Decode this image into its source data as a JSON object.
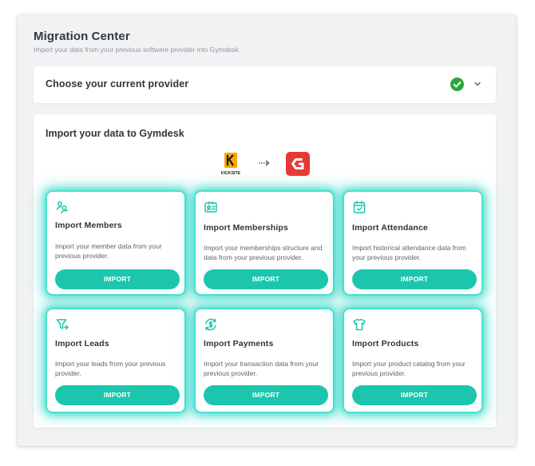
{
  "header": {
    "title": "Migration Center",
    "subtitle": "Import your data from your previous software provider into Gymdesk."
  },
  "provider": {
    "label": "Choose your current provider",
    "status_icon": "check-circle-icon",
    "status_color": "#26a83d",
    "toggle_icon": "chevron-down-icon"
  },
  "import_section": {
    "title": "Import your data to Gymdesk",
    "source_logo": {
      "name": "kicksite-logo",
      "text": "KICKSITE",
      "color": "#f7a800"
    },
    "target_logo": {
      "name": "gymdesk-logo",
      "color": "#e53935"
    },
    "arrow_icon": "dashed-arrow-right-icon"
  },
  "accent_color": "#1cc6ad",
  "tiles": [
    {
      "icon": "members-icon",
      "title": "Import Members",
      "description": "Import your member data from your previous provider.",
      "button": "IMPORT"
    },
    {
      "icon": "membership-card-icon",
      "title": "Import Memberships",
      "description": "Import your memberships structure and data from your previous provider.",
      "button": "IMPORT"
    },
    {
      "icon": "calendar-check-icon",
      "title": "Import Attendance",
      "description": "Import historical attendance data from your previous provider.",
      "button": "IMPORT"
    },
    {
      "icon": "filter-leads-icon",
      "title": "Import Leads",
      "description": "Import your leads from your previous provider.",
      "button": "IMPORT"
    },
    {
      "icon": "payments-icon",
      "title": "Import Payments",
      "description": "Import your transaction data from your previous provider.",
      "button": "IMPORT"
    },
    {
      "icon": "shirt-icon",
      "title": "Import Products",
      "description": "Import your product catalog from your previous provider.",
      "button": "IMPORT"
    }
  ]
}
